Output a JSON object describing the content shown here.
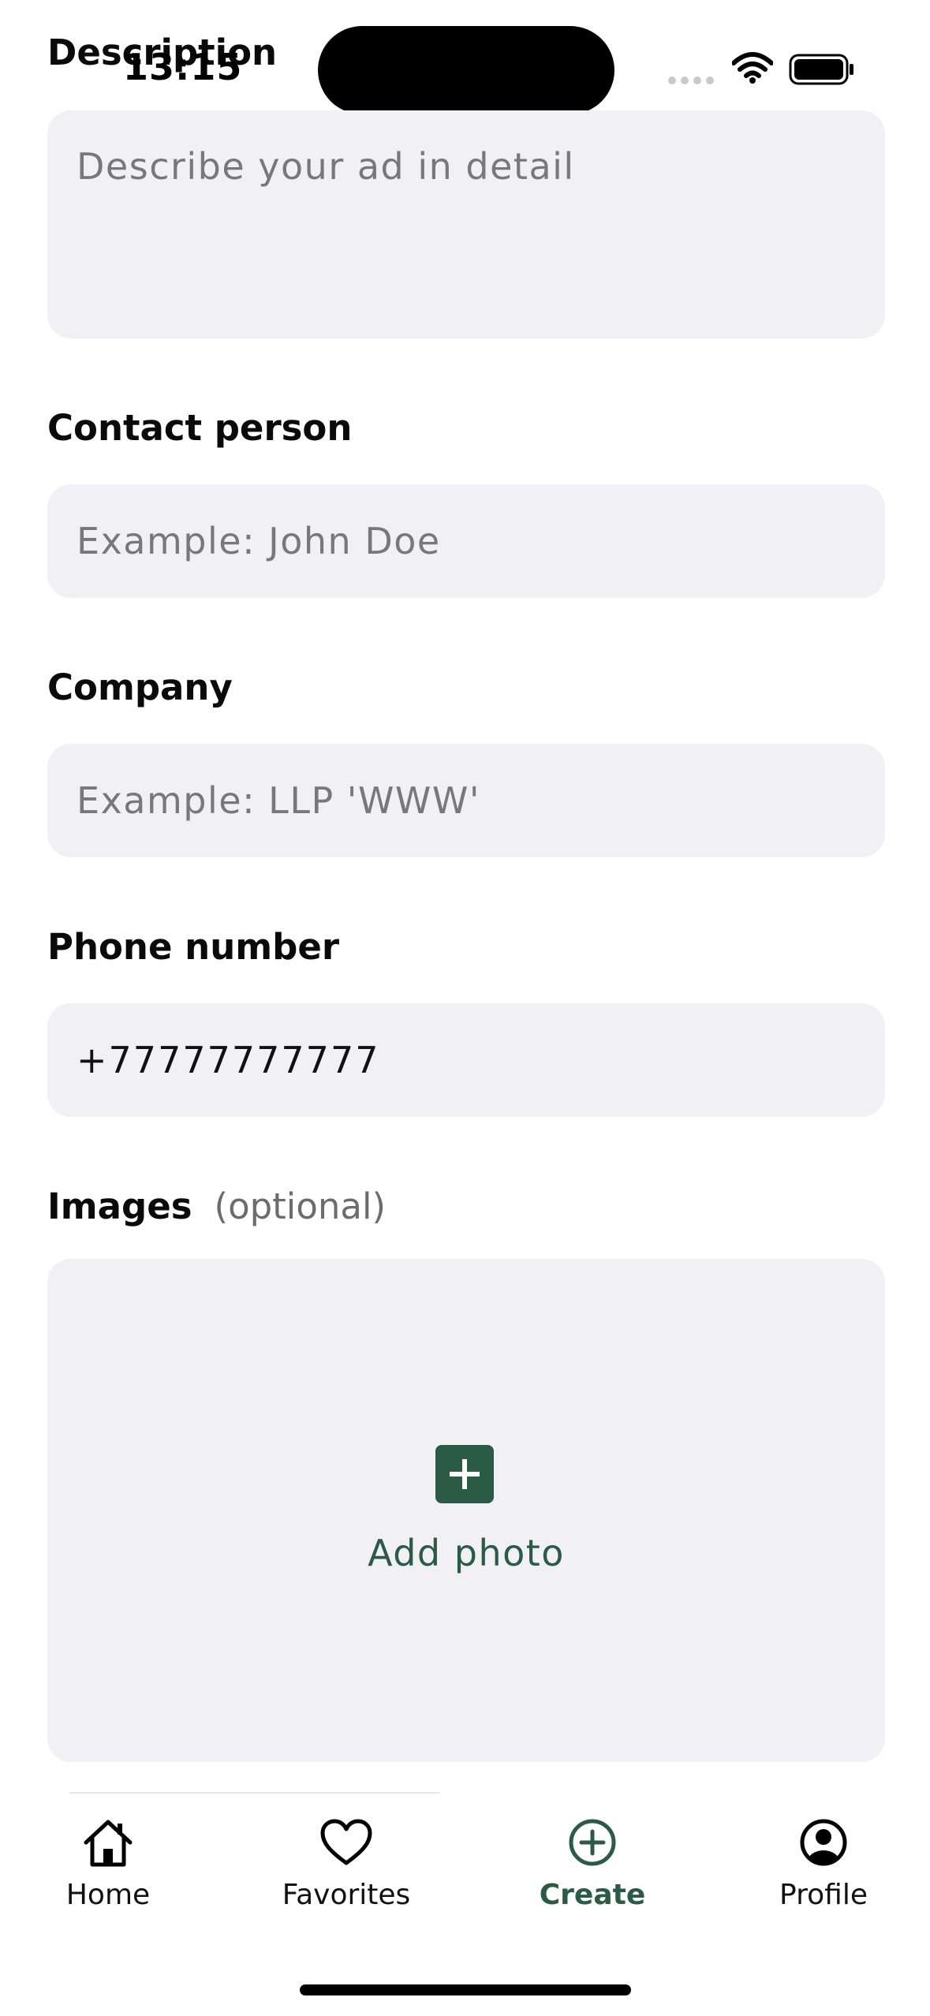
{
  "status_bar": {
    "time": "13:15"
  },
  "form": {
    "description": {
      "label": "Description",
      "placeholder": "Describe your ad in detail"
    },
    "contact_person": {
      "label": "Contact person",
      "placeholder": "Example: John Doe"
    },
    "company": {
      "label": "Company",
      "placeholder": "Example: LLP 'WWW'"
    },
    "phone": {
      "label": "Phone number",
      "value": "+77777777777"
    },
    "images": {
      "label": "Images",
      "optional_label": "(optional)",
      "add_photo_label": "Add photo"
    }
  },
  "tab_bar": {
    "items": [
      {
        "label": "Home",
        "icon": "home-icon"
      },
      {
        "label": "Favorites",
        "icon": "heart-icon"
      },
      {
        "label": "Create",
        "icon": "plus-circle-icon",
        "active": true
      },
      {
        "label": "Profile",
        "icon": "profile-icon"
      }
    ]
  },
  "colors": {
    "accent": "#2b5a45",
    "field_bg": "#f1f1f5",
    "placeholder": "#77777c"
  }
}
